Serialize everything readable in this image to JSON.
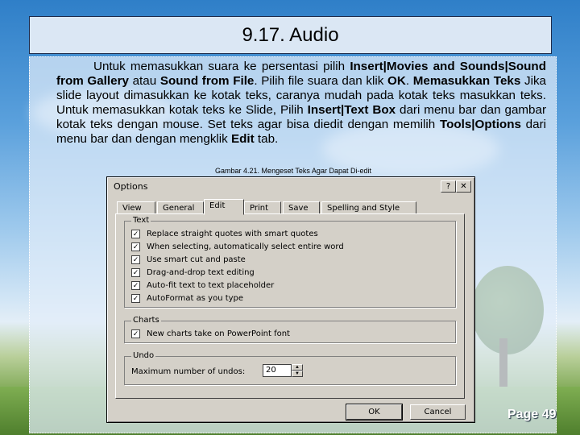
{
  "slide": {
    "title": "9.17. Audio",
    "paragraph": [
      {
        "t": "Untuk memasukkan suara ke persentasi pilih ",
        "b": false
      },
      {
        "t": "Insert|Movies and Sounds|Sound from Gallery",
        "b": true
      },
      {
        "t": " atau ",
        "b": false
      },
      {
        "t": "Sound from File",
        "b": true
      },
      {
        "t": ". Pilih file suara dan klik ",
        "b": false
      },
      {
        "t": "OK",
        "b": true
      },
      {
        "t": ". ",
        "b": false
      },
      {
        "t": "Memasukkan Teks",
        "b": true
      },
      {
        "t": " Jika slide layout dimasukkan ke kotak teks, caranya mudah pada kotak teks masukkan teks. Untuk memasukkan kotak teks ke Slide, Pilih ",
        "b": false
      },
      {
        "t": "Insert|Text Box",
        "b": true
      },
      {
        "t": " dari menu bar dan gambar kotak teks dengan mouse. Set teks agar bisa diedit dengan memilih ",
        "b": false
      },
      {
        "t": "Tools|Options",
        "b": true
      },
      {
        "t": " dari menu bar dan dengan mengklik ",
        "b": false
      },
      {
        "t": "Edit",
        "b": true
      },
      {
        "t": " tab.",
        "b": false
      }
    ],
    "caption": "Gambar 4.21. Mengeset Teks Agar Dapat Di-edit",
    "page_number": "Page 49"
  },
  "dialog": {
    "title": "Options",
    "help_button": "?",
    "close_button": "✕",
    "tabs": [
      "View",
      "General",
      "Edit",
      "Print",
      "Save",
      "Spelling and Style"
    ],
    "active_tab": "Edit",
    "groups": {
      "text": {
        "label": "Text",
        "options": [
          {
            "label": "Replace straight quotes with smart quotes",
            "checked": true
          },
          {
            "label": "When selecting, automatically select entire word",
            "checked": true
          },
          {
            "label": "Use smart cut and paste",
            "checked": true
          },
          {
            "label": "Drag-and-drop text editing",
            "checked": true
          },
          {
            "label": "Auto-fit text to text placeholder",
            "checked": true
          },
          {
            "label": "AutoFormat as you type",
            "checked": true
          }
        ]
      },
      "charts": {
        "label": "Charts",
        "options": [
          {
            "label": "New charts take on PowerPoint font",
            "checked": true
          }
        ]
      },
      "undo": {
        "label": "Undo",
        "max_label": "Maximum number of undos:",
        "value": "20"
      }
    },
    "ok_label": "OK",
    "cancel_label": "Cancel"
  }
}
